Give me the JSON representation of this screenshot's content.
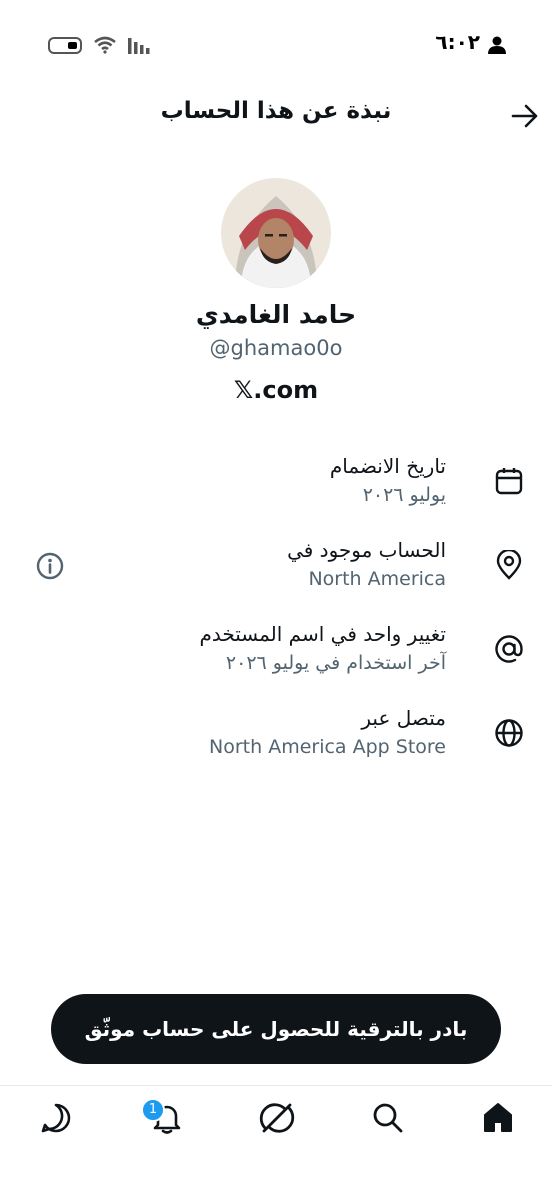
{
  "status_bar": {
    "time": "٦:٠٢"
  },
  "header": {
    "title": "نبذة عن هذا الحساب"
  },
  "profile": {
    "display_name": "حامد الغامدي",
    "handle": "@ghamao0o",
    "site": "𝕏.com"
  },
  "info": [
    {
      "icon": "calendar-icon",
      "title": "تاريخ الانضمام",
      "value": "يوليو ٢٠٢٦"
    },
    {
      "icon": "location-pin-icon",
      "title": "الحساب موجود في",
      "value": "North America"
    },
    {
      "icon": "at-sign-icon",
      "title": "تغيير واحد في اسم المستخدم",
      "value": "آخر استخدام في يوليو ٢٠٢٦"
    },
    {
      "icon": "globe-icon",
      "title": "متصل عبر",
      "value": "North America App Store"
    }
  ],
  "upgrade": {
    "label": "بادر بالترقية للحصول على حساب موثّق"
  },
  "nav": {
    "notifications_badge": "1",
    "items": [
      "home-icon",
      "search-icon",
      "grok-icon",
      "notifications-icon",
      "messages-icon"
    ]
  },
  "colors": {
    "text": "#0f1419",
    "secondary": "#536471",
    "badge": "#1d9bf0"
  }
}
